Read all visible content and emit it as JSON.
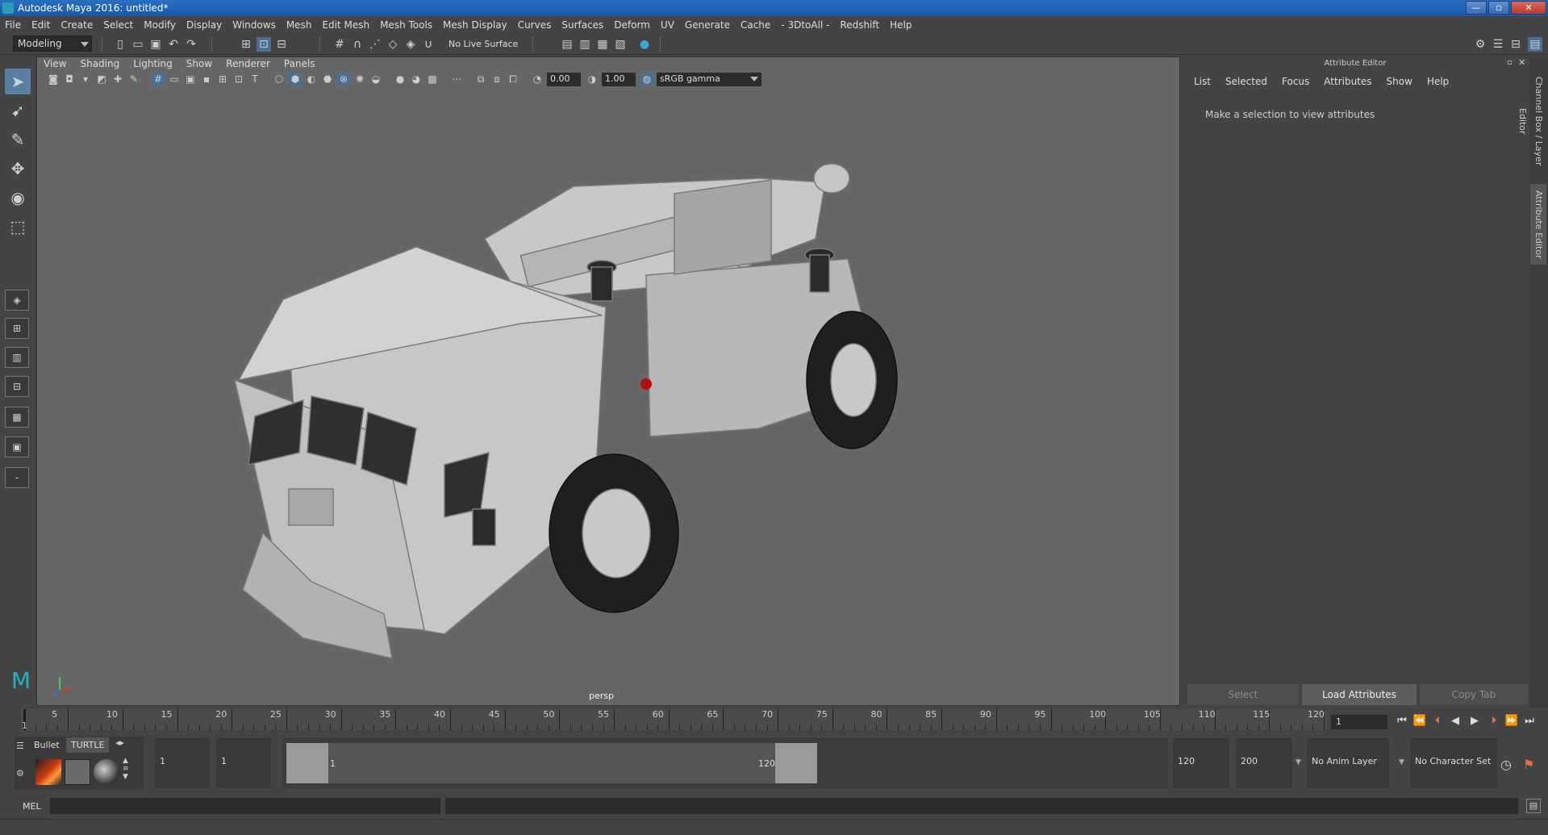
{
  "app": {
    "title": "Autodesk Maya 2016: untitled*",
    "window_buttons": [
      "—",
      "▫",
      "✕"
    ]
  },
  "menubar": [
    "File",
    "Edit",
    "Create",
    "Select",
    "Modify",
    "Display",
    "Windows",
    "Mesh",
    "Edit Mesh",
    "Mesh Tools",
    "Mesh Display",
    "Curves",
    "Surfaces",
    "Deform",
    "UV",
    "Generate",
    "Cache",
    "- 3DtoAll -",
    "Redshift",
    "Help"
  ],
  "statusline": {
    "menuset": "Modeling",
    "live_surface": "No Live Surface"
  },
  "viewport": {
    "menu": [
      "View",
      "Shading",
      "Lighting",
      "Show",
      "Renderer",
      "Panels"
    ],
    "exposure": "0.00",
    "gamma": "1.00",
    "color_space": "sRGB gamma",
    "camera": "persp",
    "axes": {
      "x": "x",
      "y": "y",
      "z": "z"
    }
  },
  "attribute_editor": {
    "title": "Attribute Editor",
    "menu": [
      "List",
      "Selected",
      "Focus",
      "Attributes",
      "Show",
      "Help"
    ],
    "message": "Make a selection to view attributes",
    "buttons": [
      "Select",
      "Load Attributes",
      "Copy Tab"
    ]
  },
  "right_tabs": [
    "Channel Box / Layer Editor",
    "Attribute Editor"
  ],
  "timeline": {
    "start": 1,
    "end": 120,
    "current_frame": "1",
    "start_label": "1",
    "tick_labels": [
      "5",
      "10",
      "15",
      "20",
      "25",
      "30",
      "35",
      "40",
      "45",
      "50",
      "55",
      "60",
      "65",
      "70",
      "75",
      "80",
      "85",
      "90",
      "95",
      "100",
      "105",
      "110",
      "115",
      "120"
    ],
    "frame_field": "1"
  },
  "shelf": {
    "tabs": [
      "Bullet",
      "TURTLE"
    ],
    "active_tab": "TURTLE"
  },
  "range": {
    "anim_start": "1",
    "playback_start": "1",
    "range_start_label": "1",
    "range_end_label": "120",
    "playback_end": "120",
    "anim_end": "200",
    "anim_layer": "No Anim Layer",
    "character_set": "No Character Set"
  },
  "cmdline": {
    "lang": "MEL"
  }
}
